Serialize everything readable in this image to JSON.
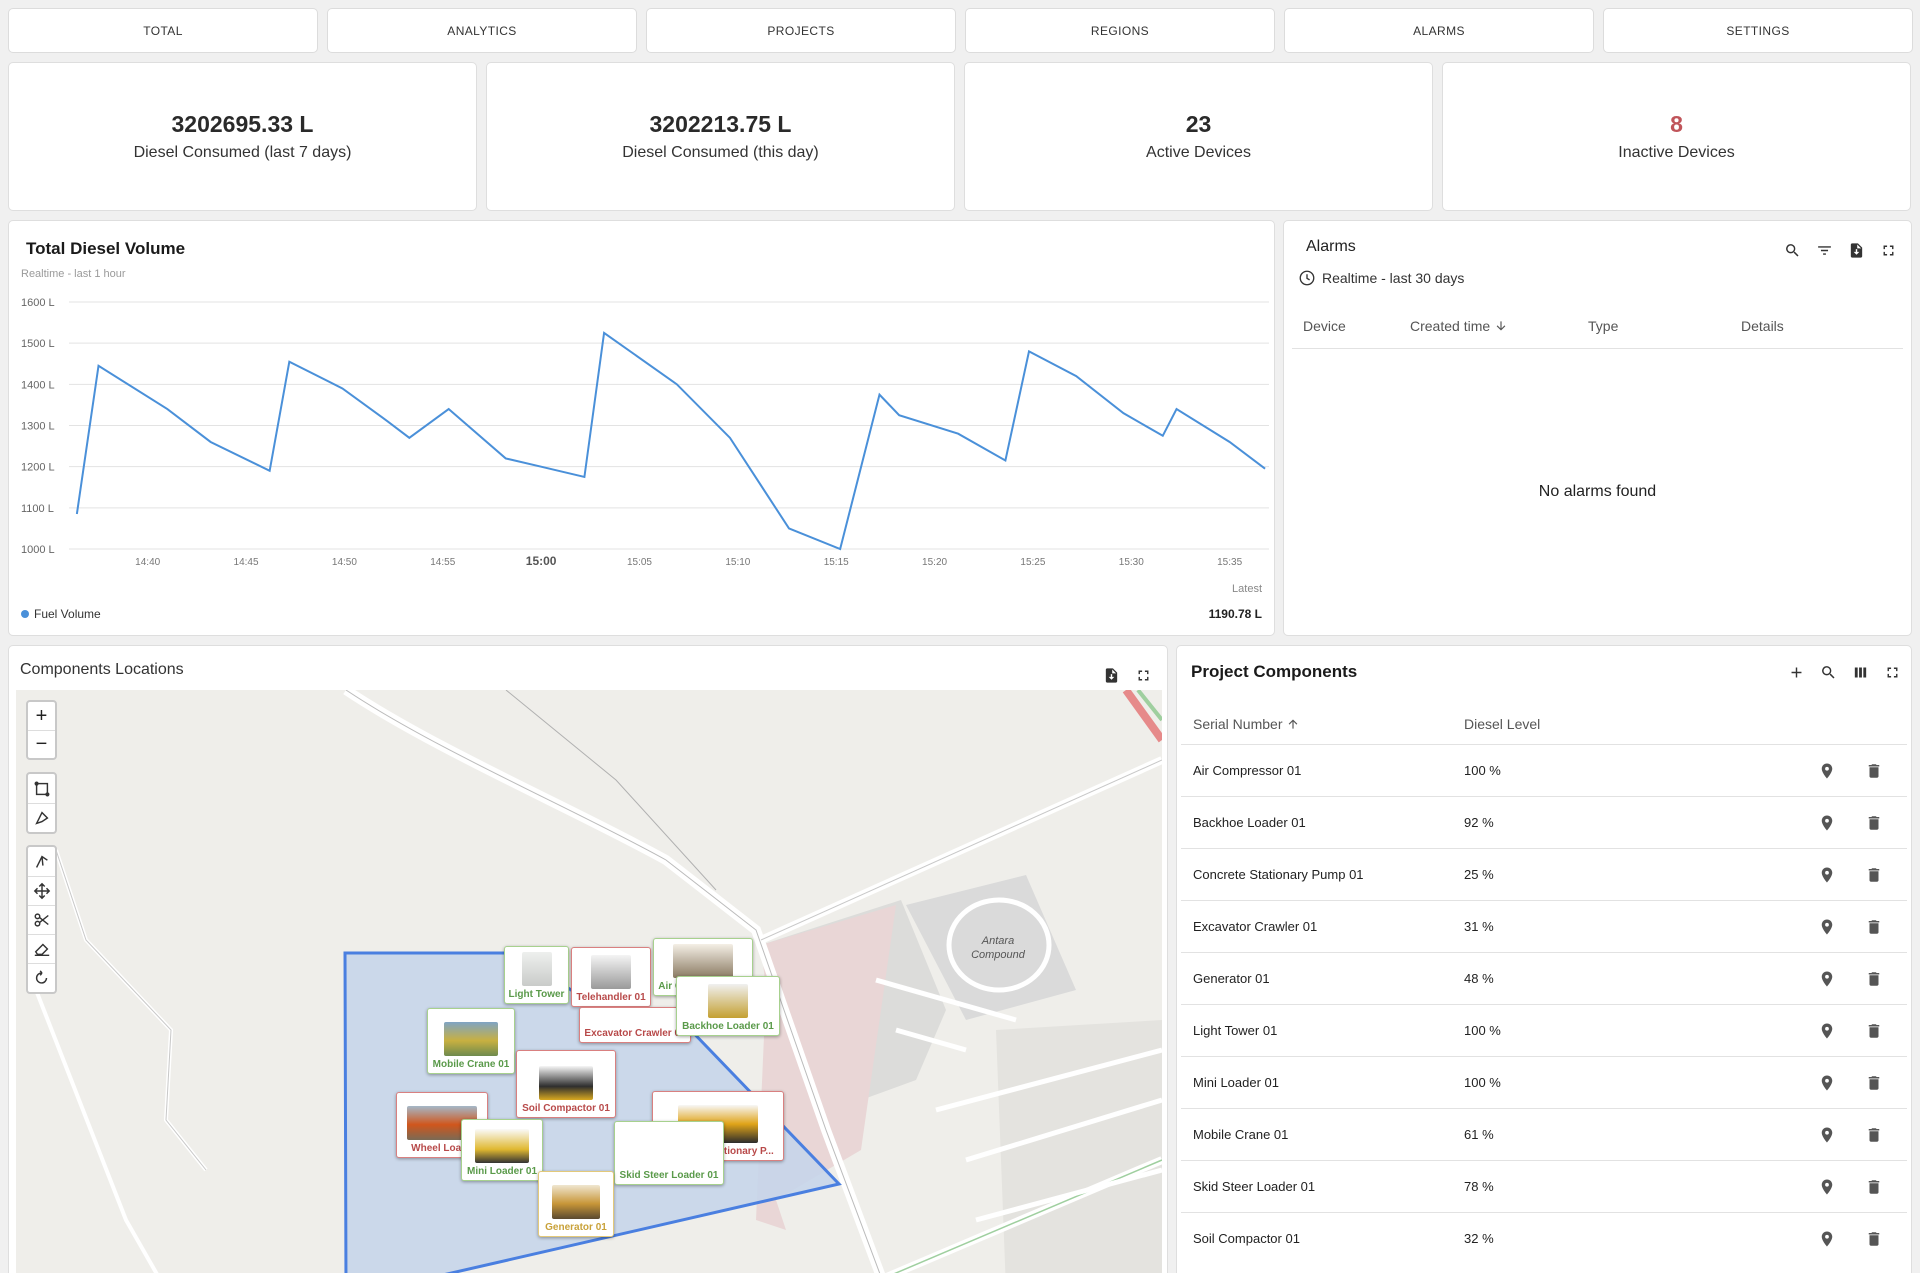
{
  "tabs": [
    "TOTAL",
    "ANALYTICS",
    "PROJECTS",
    "REGIONS",
    "ALARMS",
    "SETTINGS"
  ],
  "kpis": [
    {
      "value": "3202695.33 L",
      "label": "Diesel Consumed (last 7 days)"
    },
    {
      "value": "3202213.75 L",
      "label": "Diesel Consumed (this day)"
    },
    {
      "value": "23",
      "label": "Active Devices"
    },
    {
      "value": "8",
      "label": "Inactive Devices"
    }
  ],
  "colors": {
    "accent": "#4a90d9",
    "inactive": "#c0545a",
    "polygon_fill": "#c6d5ea",
    "polygon_stroke": "#4a7fe0"
  },
  "chart": {
    "title": "Total Diesel Volume",
    "subtitle": "Realtime - last 1 hour",
    "legend": "Fuel Volume",
    "latest_label": "Latest",
    "latest_value": "1190.78 L"
  },
  "chart_data": {
    "type": "line",
    "title": "Total Diesel Volume",
    "ylim": [
      1000,
      1600
    ],
    "y_ticks": [
      "1000 L",
      "1100 L",
      "1200 L",
      "1300 L",
      "1400 L",
      "1500 L",
      "1600 L"
    ],
    "x_ticks": [
      "14:40",
      "14:45",
      "14:50",
      "14:55",
      "15:00",
      "15:05",
      "15:10",
      "15:15",
      "15:20",
      "15:25",
      "15:30",
      "15:35"
    ],
    "x_range": [
      "14:36",
      "15:37"
    ],
    "grid": true,
    "series": [
      {
        "name": "Fuel Volume",
        "x": [
          "14:36.4",
          "14:37.5",
          "14:41",
          "14:43.2",
          "14:46.2",
          "14:47.2",
          "14:49.9",
          "14:52.2",
          "14:53.3",
          "14:55.3",
          "14:58.2",
          "15:00",
          "15:02.2",
          "15:03.2",
          "15:06.9",
          "15:09.6",
          "15:12.6",
          "15:15.2",
          "15:17.2",
          "15:18.2",
          "15:21.2",
          "15:23.6",
          "15:24.8",
          "15:27.2",
          "15:29.6",
          "15:31.6",
          "15:32.3",
          "15:35",
          "15:36.8"
        ],
        "values": [
          1085,
          1445,
          1340,
          1260,
          1190,
          1455,
          1390,
          1310,
          1270,
          1340,
          1220,
          1200,
          1175,
          1525,
          1400,
          1270,
          1050,
          1000,
          1375,
          1325,
          1280,
          1215,
          1480,
          1420,
          1330,
          1275,
          1340,
          1260,
          1195
        ]
      }
    ]
  },
  "alarms": {
    "title": "Alarms",
    "range": "Realtime - last 30 days",
    "columns": [
      "Device",
      "Created time",
      "Type",
      "Details"
    ],
    "empty_text": "No alarms found"
  },
  "map": {
    "title": "Components Locations",
    "zoom_in": "+",
    "zoom_out": "−",
    "compound_label_1": "Antara",
    "compound_label_2": "Compound",
    "markers": [
      {
        "label": "Light Tower",
        "status": "green"
      },
      {
        "label": "Telehandler 01",
        "status": "red"
      },
      {
        "label": "Air Compressor 01",
        "status": "green"
      },
      {
        "label": "Excavator Crawler 01",
        "status": "red"
      },
      {
        "label": "Backhoe Loader 01",
        "status": "green"
      },
      {
        "label": "Mobile Crane 01",
        "status": "green"
      },
      {
        "label": "Soil Compactor 01",
        "status": "red"
      },
      {
        "label": "Wheel Loade",
        "status": "red"
      },
      {
        "label": "Mini Loader 01",
        "status": "green"
      },
      {
        "label": "Concrete Stationary P...",
        "status": "red"
      },
      {
        "label": "Skid Steer Loader 01",
        "status": "green"
      },
      {
        "label": "Generator 01",
        "status": "yellow"
      }
    ]
  },
  "components": {
    "title": "Project Components",
    "columns": [
      "Serial Number",
      "Diesel Level"
    ],
    "rows": [
      {
        "serial": "Air Compressor 01",
        "level": "100 %"
      },
      {
        "serial": "Backhoe Loader 01",
        "level": "92 %"
      },
      {
        "serial": "Concrete Stationary Pump 01",
        "level": "25 %"
      },
      {
        "serial": "Excavator Crawler 01",
        "level": "31 %"
      },
      {
        "serial": "Generator 01",
        "level": "48 %"
      },
      {
        "serial": "Light Tower 01",
        "level": "100 %"
      },
      {
        "serial": "Mini Loader 01",
        "level": "100 %"
      },
      {
        "serial": "Mobile Crane 01",
        "level": "61 %"
      },
      {
        "serial": "Skid Steer Loader 01",
        "level": "78 %"
      },
      {
        "serial": "Soil Compactor 01",
        "level": "32 %"
      }
    ]
  }
}
